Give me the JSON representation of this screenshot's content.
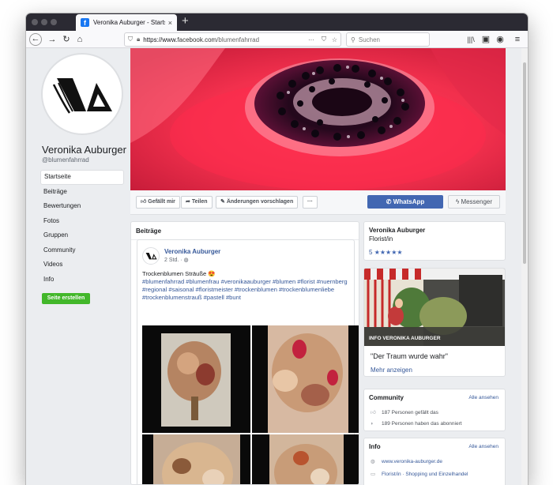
{
  "browser": {
    "tab_title": "Veronika Auburger - Startseite",
    "tab_favicon": "f",
    "tab_close": "×",
    "new_tab": "+",
    "url_protocol": "https://www.",
    "url_host": "facebook.com",
    "url_path": "/blumenfahrrad",
    "search_placeholder": "Suchen"
  },
  "profile": {
    "name": "Veronika Auburger",
    "handle": "@blumenfahrrad",
    "nav": [
      "Startseite",
      "Beiträge",
      "Bewertungen",
      "Fotos",
      "Gruppen",
      "Community",
      "Videos",
      "Info"
    ],
    "create_page": "Seite erstellen"
  },
  "actions": {
    "like": "Gefällt mir",
    "share": "Teilen",
    "suggest": "Änderungen vorschlagen",
    "more": "···",
    "whatsapp": "WhatsApp",
    "messenger": "Messenger"
  },
  "feed": {
    "header": "Beiträge",
    "post": {
      "author": "Veronika Auburger",
      "time": "2 Std. ·",
      "text": "Trockenblumen Sträuße 😍",
      "hashtags": "#blumenfahrrad #blumenfrau #veronikaauburger #blumen #florist #nuernberg #regional #saisonal #floristmeister #trockenblumen #trockenblumenliebe #trockenblumenstrauß #pastell #bunt"
    }
  },
  "sidebar": {
    "about_name": "Veronika Auburger",
    "about_category": "Florist/in",
    "rating_value": "5",
    "rating_stars": "★★★★★",
    "photo_caption": "INFO VERONIKA AUBURGER",
    "quote": "\"Der Traum wurde wahr\"",
    "more": "Mehr anzeigen",
    "community_title": "Community",
    "community_see_all": "Alle ansehen",
    "community_likes": "187 Personen gefällt das",
    "community_follows": "189 Personen haben das abonniert",
    "info_title": "Info",
    "info_see_all": "Alle ansehen",
    "website": "www.veronika-auburger.de",
    "category_line": "Florist/in · Shopping und Einzelhandel"
  },
  "colors": {
    "facebook_blue": "#4267b2",
    "link": "#365899",
    "create_green": "#42b72a",
    "page_bg": "#ebedf0"
  }
}
